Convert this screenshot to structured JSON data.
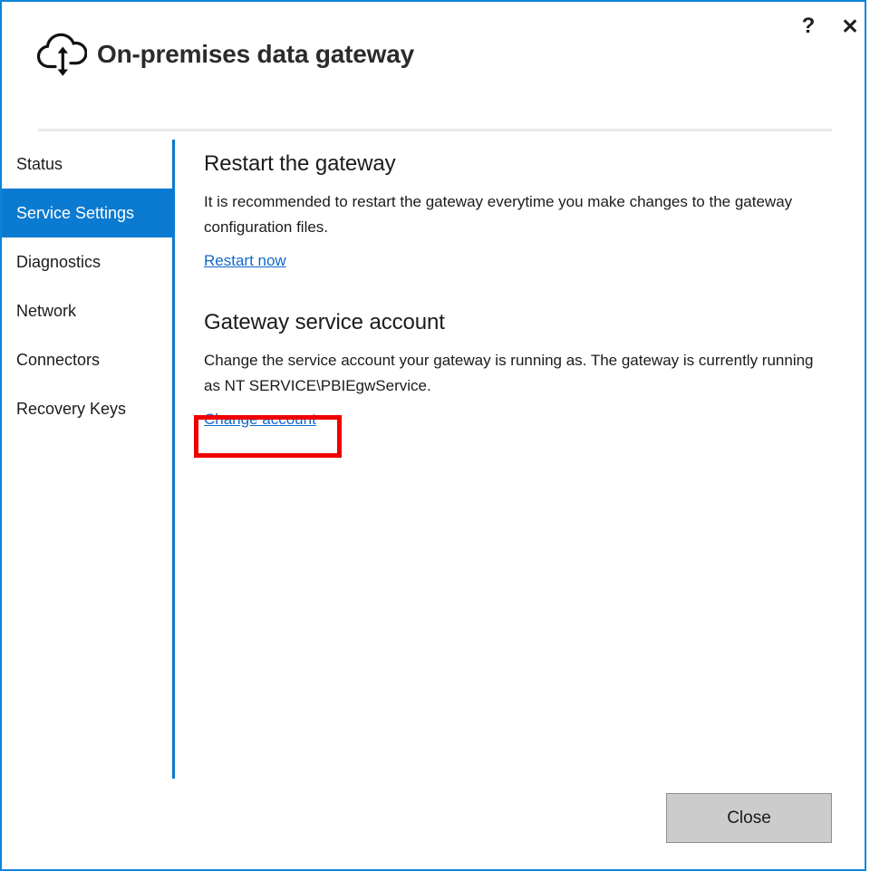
{
  "window": {
    "title": "On-premises data gateway",
    "icon": "cloud-sync-icon",
    "accent_color": "#0b7ad1",
    "border_color": "#0b84da",
    "help_label": "?",
    "close_label": "✕"
  },
  "sidebar": {
    "items": [
      {
        "label": "Status",
        "selected": false
      },
      {
        "label": "Service Settings",
        "selected": true
      },
      {
        "label": "Diagnostics",
        "selected": false
      },
      {
        "label": "Network",
        "selected": false
      },
      {
        "label": "Connectors",
        "selected": false
      },
      {
        "label": "Recovery Keys",
        "selected": false
      }
    ]
  },
  "content": {
    "restart_section": {
      "heading": "Restart the gateway",
      "body": "It is recommended to restart the gateway everytime you make changes to the gateway configuration files.",
      "link": "Restart now"
    },
    "account_section": {
      "heading": "Gateway service account",
      "body": "Change the service account your gateway is running as. The gateway is currently running as NT SERVICE\\PBIEgwService.",
      "link": "Change account"
    }
  },
  "highlight": {
    "color": "#ef0000",
    "target": "Change account"
  },
  "footer": {
    "close_label": "Close"
  }
}
